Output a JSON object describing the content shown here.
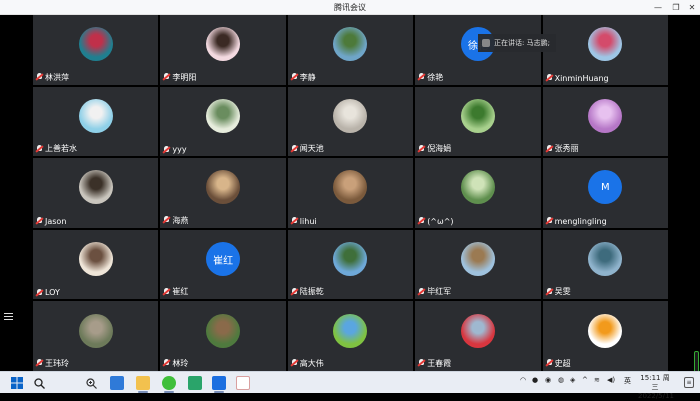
{
  "window": {
    "title": "腾讯会议",
    "controls": [
      "minimize",
      "restore",
      "close"
    ]
  },
  "speaking_indicator": {
    "label": "正在讲话: 马志鹏;"
  },
  "participants": [
    {
      "name": "林洪萍",
      "avatar": {
        "type": "photo",
        "color": "#1f7f90",
        "accent": "#c0304a"
      }
    },
    {
      "name": "李明阳",
      "avatar": {
        "type": "photo",
        "color": "#f3d9e0",
        "accent": "#3b2a24"
      }
    },
    {
      "name": "李静",
      "avatar": {
        "type": "photo",
        "color": "#6fa5c8",
        "accent": "#4d7a3a"
      }
    },
    {
      "name": "徐艳",
      "avatar": {
        "type": "text",
        "text": "徐艳",
        "color": "#1a73e8"
      }
    },
    {
      "name": "XinminHuang",
      "avatar": {
        "type": "photo",
        "color": "#9ec6e6",
        "accent": "#d44b6b"
      }
    },
    {
      "name": "上善若水",
      "avatar": {
        "type": "photo",
        "color": "#8fd0e8",
        "accent": "#f1f1f1"
      }
    },
    {
      "name": "yyy",
      "avatar": {
        "type": "photo",
        "color": "#e6ecdc",
        "accent": "#6a8d5f"
      }
    },
    {
      "name": "闻天池",
      "avatar": {
        "type": "photo",
        "color": "#b9b3aa",
        "accent": "#e8e4dc"
      }
    },
    {
      "name": "倪海娟",
      "avatar": {
        "type": "photo",
        "color": "#a8d08d",
        "accent": "#3c7a2e"
      }
    },
    {
      "name": "张秀丽",
      "avatar": {
        "type": "photo",
        "color": "#b677c7",
        "accent": "#e7c1ef"
      }
    },
    {
      "name": "Jason",
      "avatar": {
        "type": "photo",
        "color": "#c9c5bd",
        "accent": "#3b3128"
      }
    },
    {
      "name": "海燕",
      "avatar": {
        "type": "photo",
        "color": "#6b4f3a",
        "accent": "#d8b58a"
      }
    },
    {
      "name": "lihui",
      "avatar": {
        "type": "photo",
        "color": "#7b5a3c",
        "accent": "#c9a07a"
      }
    },
    {
      "name": "(^ω^)",
      "avatar": {
        "type": "photo",
        "color": "#5f8f4e",
        "accent": "#cfe3b8"
      }
    },
    {
      "name": "menglingling",
      "avatar": {
        "type": "text",
        "text": "M",
        "color": "#1a73e8"
      }
    },
    {
      "name": "LOY",
      "avatar": {
        "type": "photo",
        "color": "#efe5d8",
        "accent": "#6b5040"
      }
    },
    {
      "name": "崔红",
      "avatar": {
        "type": "text",
        "text": "崔红",
        "color": "#1a73e8"
      }
    },
    {
      "name": "陆振乾",
      "avatar": {
        "type": "photo",
        "color": "#6ea8d8",
        "accent": "#3f6f3a"
      }
    },
    {
      "name": "毕红军",
      "avatar": {
        "type": "photo",
        "color": "#9fc2de",
        "accent": "#9b7a52"
      }
    },
    {
      "name": "吴雯",
      "avatar": {
        "type": "photo",
        "color": "#8fb3cc",
        "accent": "#3e6b7d"
      }
    },
    {
      "name": "王玮玲",
      "avatar": {
        "type": "photo",
        "color": "#6d7a5a",
        "accent": "#a79c8a"
      }
    },
    {
      "name": "林玲",
      "avatar": {
        "type": "photo",
        "color": "#4f7a3e",
        "accent": "#8a6a4a"
      }
    },
    {
      "name": "高大伟",
      "avatar": {
        "type": "photo",
        "color": "#7fc241",
        "accent": "#5aa6e0"
      }
    },
    {
      "name": "王春霞",
      "avatar": {
        "type": "photo",
        "color": "#d8363f",
        "accent": "#9fb8d0"
      }
    },
    {
      "name": "史超",
      "avatar": {
        "type": "photo",
        "color": "#ffffff",
        "accent": "#f29a1c"
      }
    }
  ],
  "taskbar": {
    "icons": [
      "windows-start-icon",
      "search-icon",
      "magnifier-icon",
      "store-icon",
      "file-explorer-icon",
      "wechat-icon",
      "meeting-icon",
      "tencent-meeting-icon",
      "paint-icon"
    ],
    "tray": {
      "ime": "英",
      "date_line1": "15:11 周三",
      "date_line2": "2022/5/11"
    }
  }
}
